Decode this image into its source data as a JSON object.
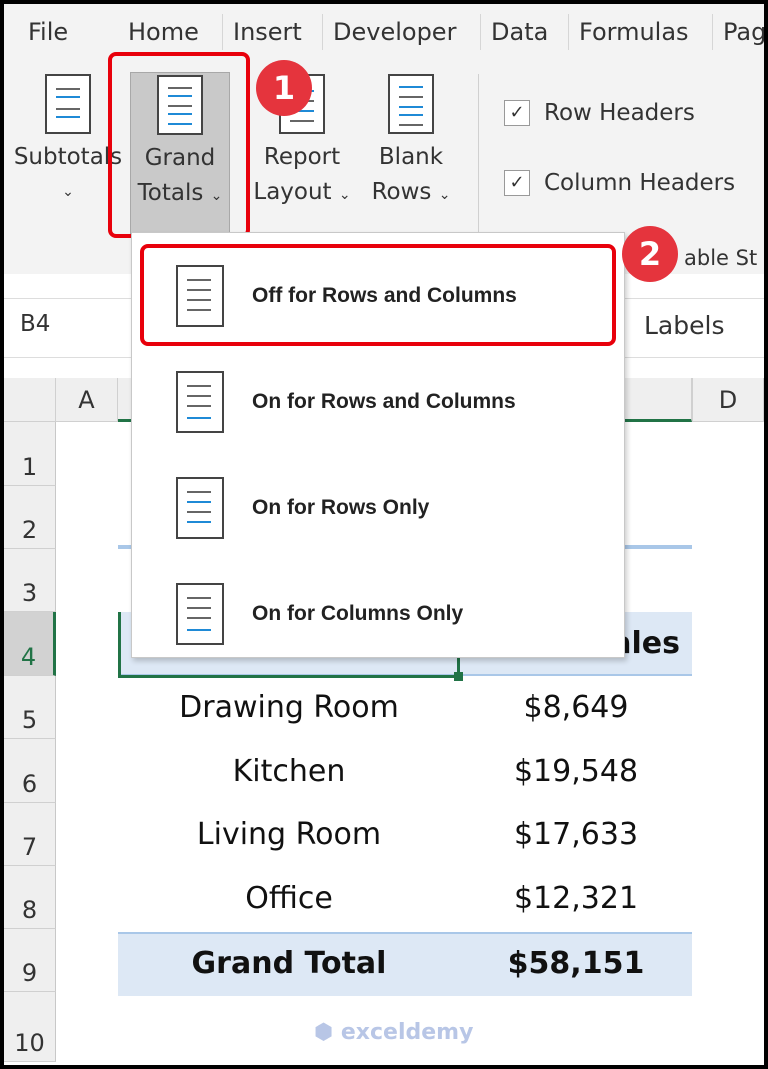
{
  "tabs": [
    "File",
    "Home",
    "Insert",
    "Developer",
    "Data",
    "Formulas",
    "Pag"
  ],
  "ribbon": {
    "buttons": [
      {
        "label1": "Subtotals",
        "label2": ""
      },
      {
        "label1": "Grand",
        "label2": "Totals"
      },
      {
        "label1": "Report",
        "label2": "Layout"
      },
      {
        "label1": "Blank",
        "label2": "Rows"
      }
    ],
    "checkboxes": [
      {
        "label": "Row Headers",
        "checked": true
      },
      {
        "label": "Column Headers",
        "checked": true
      }
    ],
    "group_label_partial": "able St"
  },
  "callouts": [
    "1",
    "2"
  ],
  "formula_bar": {
    "name_box": "B4",
    "content_partial": "Labels"
  },
  "columns": [
    "A",
    "",
    "D"
  ],
  "rows": [
    "1",
    "2",
    "3",
    "4",
    "5",
    "6",
    "7",
    "8",
    "9",
    "10"
  ],
  "menu": {
    "items": [
      "Off for Rows and Columns",
      "On for Rows and Columns",
      "On for Rows Only",
      "On for Columns Only"
    ],
    "selected": 0
  },
  "pivot": {
    "header_partial": "ales",
    "data": [
      {
        "label": "Drawing Room",
        "value": "$8,649"
      },
      {
        "label": "Kitchen",
        "value": "$19,548"
      },
      {
        "label": "Living Room",
        "value": "$17,633"
      },
      {
        "label": "Office",
        "value": "$12,321"
      }
    ],
    "total": {
      "label": "Grand Total",
      "value": "$58,151"
    }
  },
  "watermark": "exceldemy",
  "colors": {
    "accent_red": "#e8000b",
    "badge": "#e5343d",
    "pivot_band": "#dde8f5",
    "selection": "#217346"
  }
}
